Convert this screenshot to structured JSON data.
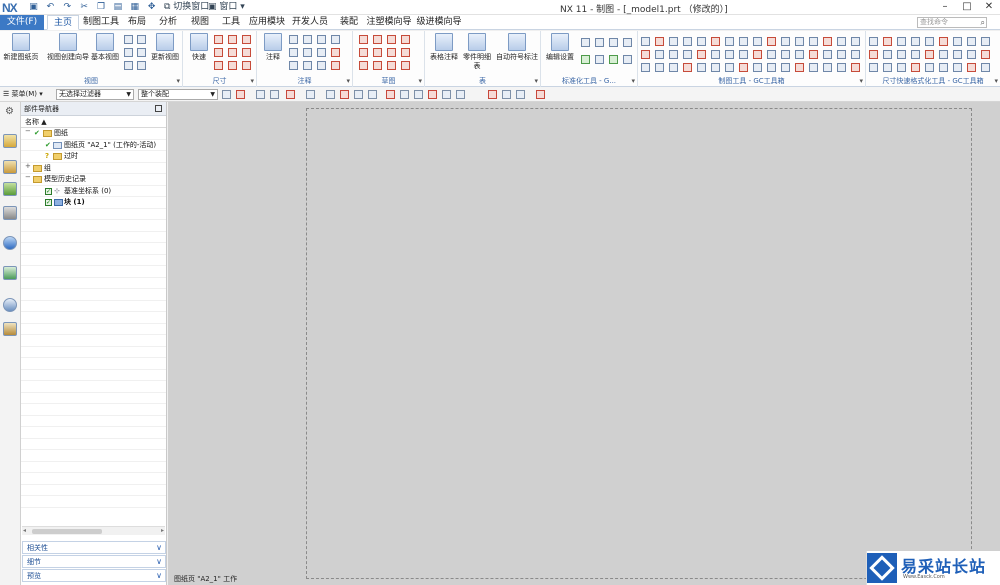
{
  "app": {
    "logo": "NX",
    "window_title": "NX 11 - 制图 - [_model1.prt （修改的）]"
  },
  "quick_access": {
    "switch_window": "切换窗口",
    "window": "窗口"
  },
  "tabs": [
    {
      "label": "文件(F)"
    },
    {
      "label": "主页"
    },
    {
      "label": "制图工具"
    },
    {
      "label": "布局"
    },
    {
      "label": "分析"
    },
    {
      "label": "视图"
    },
    {
      "label": "工具"
    },
    {
      "label": "应用模块"
    },
    {
      "label": "开发人员"
    },
    {
      "label": "装配"
    },
    {
      "label": "注塑模向导"
    },
    {
      "label": "级进模向导"
    }
  ],
  "command_search": {
    "placeholder": "查找命令"
  },
  "ribbon": {
    "new_sheet": "新建图纸页",
    "view_wizard": "视图创建向导",
    "base_view": "基本视图",
    "update_view": "更新视图",
    "group_view": "视图",
    "rapid": "快速",
    "group_dimension": "尺寸",
    "note": "注释",
    "group_annotation": "注释",
    "group_sketch": "草图",
    "table_note": "表格注释",
    "parts_list": "零件明细表",
    "auto_balloon": "自动符号标注",
    "group_table": "表",
    "edit_settings": "编辑设置",
    "group_std": "标准化工具 - G...",
    "group_drawing_tools": "制图工具 - GC工具箱",
    "group_dim_quick": "尺寸快速格式化工具 - GC工具箱"
  },
  "toolbar2": {
    "menu": "菜单(M)",
    "filter": "无选择过滤器",
    "scope": "整个装配"
  },
  "navigator": {
    "title": "部件导航器",
    "col_name": "名称",
    "rows": [
      {
        "label": "图纸"
      },
      {
        "label": "图纸页 \"A2_1\" (工作的-活动)"
      },
      {
        "label": "过时"
      },
      {
        "label": "组"
      },
      {
        "label": "模型历史记录"
      },
      {
        "label": "基准坐标系 (0)"
      },
      {
        "label": "块 (1)"
      }
    ],
    "panels": [
      {
        "label": "相关性"
      },
      {
        "label": "细节"
      },
      {
        "label": "预览"
      }
    ]
  },
  "status": {
    "text": "图纸页 \"A2_1\" 工作"
  },
  "watermark": {
    "text": "易采站长站",
    "sub": "Www.Easck.Com"
  },
  "colors": {
    "accent": "#3c79c5",
    "canvas": "#d0d0d0"
  }
}
